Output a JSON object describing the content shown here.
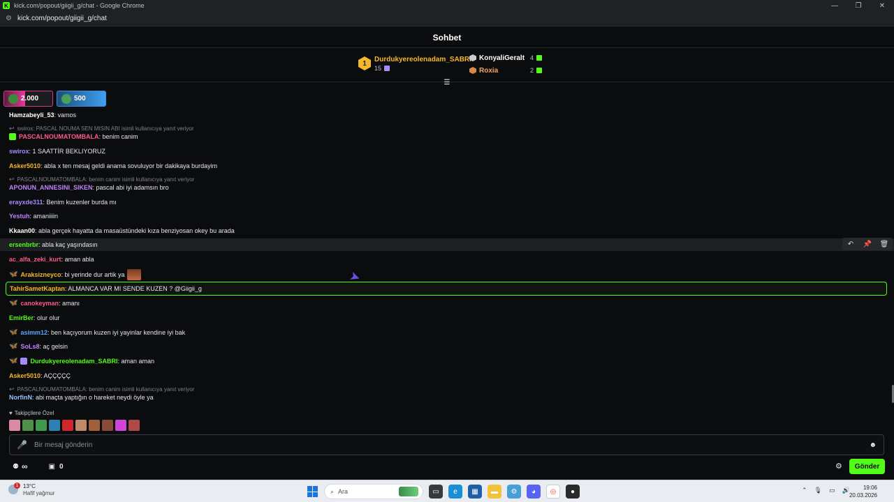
{
  "browser": {
    "window_title": "kick.com/popout/giigii_g/chat - Google Chrome",
    "url": "kick.com/popout/giigii_g/chat",
    "favicon": "kick-icon"
  },
  "chat": {
    "title": "Sohbet",
    "leaderboard": {
      "first": {
        "rank": "1",
        "name": "Durdukyereolenadam_SABRI",
        "count": "15"
      },
      "others": [
        {
          "name": "KonyaliGeralt",
          "count": "4",
          "color": "#ffffff",
          "medal": "#c9ccd1"
        },
        {
          "name": "Roxia",
          "count": "2",
          "color": "#f0a868",
          "medal": "#d8894a"
        }
      ]
    },
    "goals": [
      {
        "value": "2.000"
      },
      {
        "value": "500"
      }
    ],
    "messages": [
      {
        "user": "Hamzabeyli_53",
        "color": "#ffffff",
        "text": ": vamos"
      },
      {
        "reply": "swirox: PASCAL NOUMA SEN MISIN ABI isimli kullanıcıya yanıt veriyor",
        "user": "PASCALNOUMATOMBALA",
        "color": "#ff5a8a",
        "text": ": benim canim"
      },
      {
        "user": "swirox",
        "color": "#a78bfa",
        "text": ": 1 SAATTİR BEKLIYORUZ"
      },
      {
        "user": "Asker5010",
        "color": "#f5b82a",
        "text": ": abla x ten mesaj geldi anama sovuluyor bir dakikaya burdayim"
      },
      {
        "reply": "PASCALNOUMATOMBALA: benim canim isimli kullanıcıya yanıt veriyor",
        "user": "APONUN_ANNESINI_SIKEN",
        "color": "#c084fc",
        "text": ": pascal abi iyi adamsın bro"
      },
      {
        "user": "erayxde311",
        "color": "#a78bfa",
        "text": ": Benim kuzenler burda mı"
      },
      {
        "user": "Yestuh",
        "color": "#c084fc",
        "text": ": amaniiiin"
      },
      {
        "user": "Kkaan00",
        "color": "#ffffff",
        "text": ": abla gerçek hayatta da masaüstündeki kıza benziyosan okey bu arada"
      },
      {
        "user": "ersenbrbr",
        "color": "#53fc18",
        "text": ": abla kaç yaşındasın"
      },
      {
        "user": "ac_alfa_zeki_kurt",
        "color": "#ff5a8a",
        "text": ": aman abla"
      },
      {
        "user": "Araksizneyco",
        "color": "#f5b82a",
        "text": ": bi yerinde dur artik ya"
      },
      {
        "user": "TahirSametKaptan",
        "color": "#f5b82a",
        "text": ": ALMANCA VAR MI SENDE KUZEN ? @Giigii_g"
      },
      {
        "user": "canokeyman",
        "color": "#ff5a8a",
        "text": ": amanı"
      },
      {
        "user": "EmirBer",
        "color": "#53fc18",
        "text": ": olur olur"
      },
      {
        "user": "asimm12",
        "color": "#60a5fa",
        "text": ": ben kaçıyorum kuzen iyi yayinlar kendine iyi bak"
      },
      {
        "user": "SoLs8",
        "color": "#c084fc",
        "text": ": aç gelsin"
      },
      {
        "user": "Durdukyereolenadam_SABRI",
        "color": "#53fc18",
        "text": ": aman aman"
      },
      {
        "user": "Asker5010",
        "color": "#f5b82a",
        "text": ": AÇÇÇÇÇ"
      },
      {
        "reply": "PASCALNOUMATOMBALA: benim canim isimli kullanıcıya yanıt veriyor",
        "user": "NorfinN",
        "color": "#93c5fd",
        "text": ": abi maçta yaptığın o hareket neydi öyle ya"
      }
    ],
    "emote_section_label": "Takipçilere Özel",
    "input_placeholder": "Bir mesaj gönderin",
    "bottom": {
      "store_count": "0",
      "send_label": "Gönder"
    },
    "accent": "#53fc18"
  },
  "taskbar": {
    "weather_temp": "13°C",
    "weather_desc": "Hafif yağmur",
    "weather_badge": "1",
    "search_label": "Ara",
    "time": "19:06",
    "date": "20.03.2026"
  }
}
